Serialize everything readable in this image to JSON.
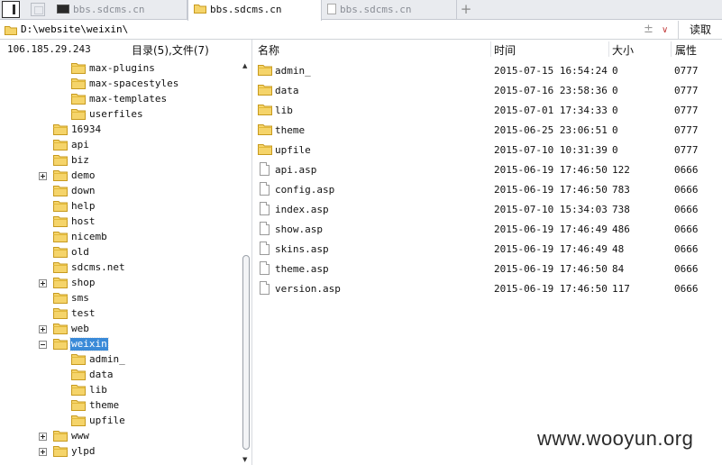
{
  "tabs": [
    {
      "label": "bbs.sdcms.cn",
      "icon": "terminal-icon",
      "active": false
    },
    {
      "label": "bbs.sdcms.cn",
      "icon": "folder-icon",
      "active": true
    },
    {
      "label": "bbs.sdcms.cn",
      "icon": "document-icon",
      "active": false
    }
  ],
  "new_tab": "+",
  "address": {
    "path": "D:\\website\\weixin\\",
    "add_symbol": "±",
    "dropdown_symbol": "∨",
    "go_label": "读取"
  },
  "left": {
    "ip": "106.185.29.243",
    "summary": "目录(5),文件(7)",
    "tree": [
      {
        "label": "max-plugins",
        "depth": 2
      },
      {
        "label": "max-spacestyles",
        "depth": 2
      },
      {
        "label": "max-templates",
        "depth": 2
      },
      {
        "label": "userfiles",
        "depth": 2
      },
      {
        "label": "16934",
        "depth": 1
      },
      {
        "label": "api",
        "depth": 1
      },
      {
        "label": "biz",
        "depth": 1
      },
      {
        "label": "demo",
        "depth": 1,
        "toggle": "+"
      },
      {
        "label": "down",
        "depth": 1
      },
      {
        "label": "help",
        "depth": 1
      },
      {
        "label": "host",
        "depth": 1
      },
      {
        "label": "nicemb",
        "depth": 1
      },
      {
        "label": "old",
        "depth": 1
      },
      {
        "label": "sdcms.net",
        "depth": 1
      },
      {
        "label": "shop",
        "depth": 1,
        "toggle": "+"
      },
      {
        "label": "sms",
        "depth": 1
      },
      {
        "label": "test",
        "depth": 1
      },
      {
        "label": "web",
        "depth": 1,
        "toggle": "+"
      },
      {
        "label": "weixin",
        "depth": 1,
        "toggle": "-",
        "selected": true,
        "open": true
      },
      {
        "label": "admin_",
        "depth": 2
      },
      {
        "label": "data",
        "depth": 2
      },
      {
        "label": "lib",
        "depth": 2
      },
      {
        "label": "theme",
        "depth": 2
      },
      {
        "label": "upfile",
        "depth": 2
      },
      {
        "label": "www",
        "depth": 1,
        "toggle": "+"
      },
      {
        "label": "ylpd",
        "depth": 1,
        "toggle": "+"
      }
    ]
  },
  "columns": {
    "name": "名称",
    "time": "时间",
    "size": "大小",
    "attr": "属性"
  },
  "files": [
    {
      "name": "admin_",
      "time": "2015-07-15 16:54:24",
      "size": "0",
      "attr": "0777",
      "type": "folder"
    },
    {
      "name": "data",
      "time": "2015-07-16 23:58:36",
      "size": "0",
      "attr": "0777",
      "type": "folder"
    },
    {
      "name": "lib",
      "time": "2015-07-01 17:34:33",
      "size": "0",
      "attr": "0777",
      "type": "folder"
    },
    {
      "name": "theme",
      "time": "2015-06-25 23:06:51",
      "size": "0",
      "attr": "0777",
      "type": "folder"
    },
    {
      "name": "upfile",
      "time": "2015-07-10 10:31:39",
      "size": "0",
      "attr": "0777",
      "type": "folder"
    },
    {
      "name": "api.asp",
      "time": "2015-06-19 17:46:50",
      "size": "122",
      "attr": "0666",
      "type": "file"
    },
    {
      "name": "config.asp",
      "time": "2015-06-19 17:46:50",
      "size": "783",
      "attr": "0666",
      "type": "file"
    },
    {
      "name": "index.asp",
      "time": "2015-07-10 15:34:03",
      "size": "738",
      "attr": "0666",
      "type": "file"
    },
    {
      "name": "show.asp",
      "time": "2015-06-19 17:46:49",
      "size": "486",
      "attr": "0666",
      "type": "file"
    },
    {
      "name": "skins.asp",
      "time": "2015-06-19 17:46:49",
      "size": "48",
      "attr": "0666",
      "type": "file"
    },
    {
      "name": "theme.asp",
      "time": "2015-06-19 17:46:50",
      "size": "84",
      "attr": "0666",
      "type": "file"
    },
    {
      "name": "version.asp",
      "time": "2015-06-19 17:46:50",
      "size": "117",
      "attr": "0666",
      "type": "file"
    }
  ],
  "watermark": "www.wooyun.org",
  "colors": {
    "selection": "#3a8ad8",
    "folder": "#f5d46a",
    "folder_edge": "#c79a1e"
  }
}
